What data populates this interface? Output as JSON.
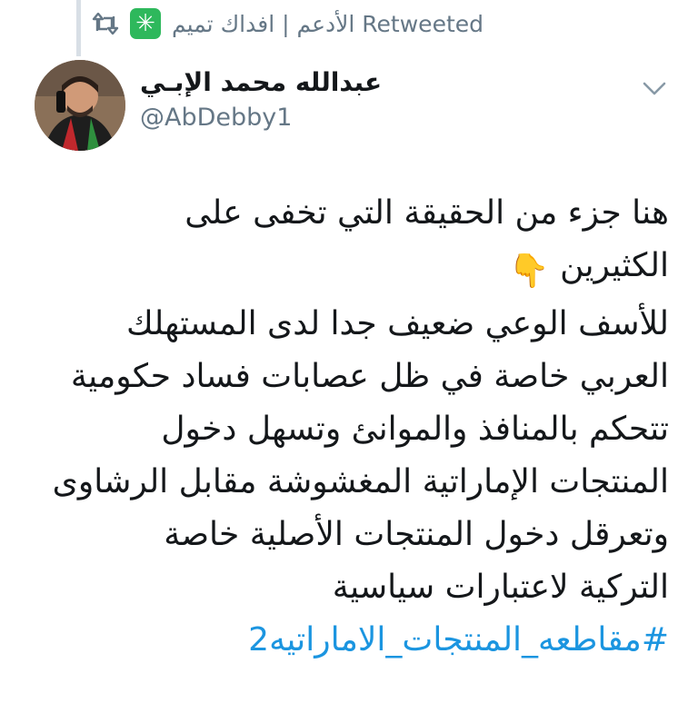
{
  "retweet": {
    "text": "الأدعم | افداك تميم Retweeted",
    "badge_icon": "asterisk-star-icon",
    "badge_color": "#2eb85c"
  },
  "author": {
    "name": "عبدالله محمد الإبـي",
    "handle": "@AbDebby1"
  },
  "tweet": {
    "lines": [
      "هنا جزء من الحقيقة التي تخفى على",
      "الكثيرين",
      "للأسف الوعي ضعيف جدا لدى المستهلك",
      "العربي خاصة في ظل عصابات فساد حكومية",
      "تتحكم بالمنافذ والموانئ وتسهل دخول",
      "المنتجات الإماراتية المغشوشة مقابل الرشاوى",
      "وتعرقل دخول المنتجات الأصلية خاصة",
      "التركية لاعتبارات سياسية"
    ],
    "emoji": "👇",
    "emoji_name": "pointing-down-hand-icon",
    "hashtag": "#مقاطعه_المنتجات_الاماراتيه2"
  },
  "colors": {
    "hashtag": "#1b95e0",
    "secondary_text": "#657786",
    "primary_text": "#14171a"
  }
}
